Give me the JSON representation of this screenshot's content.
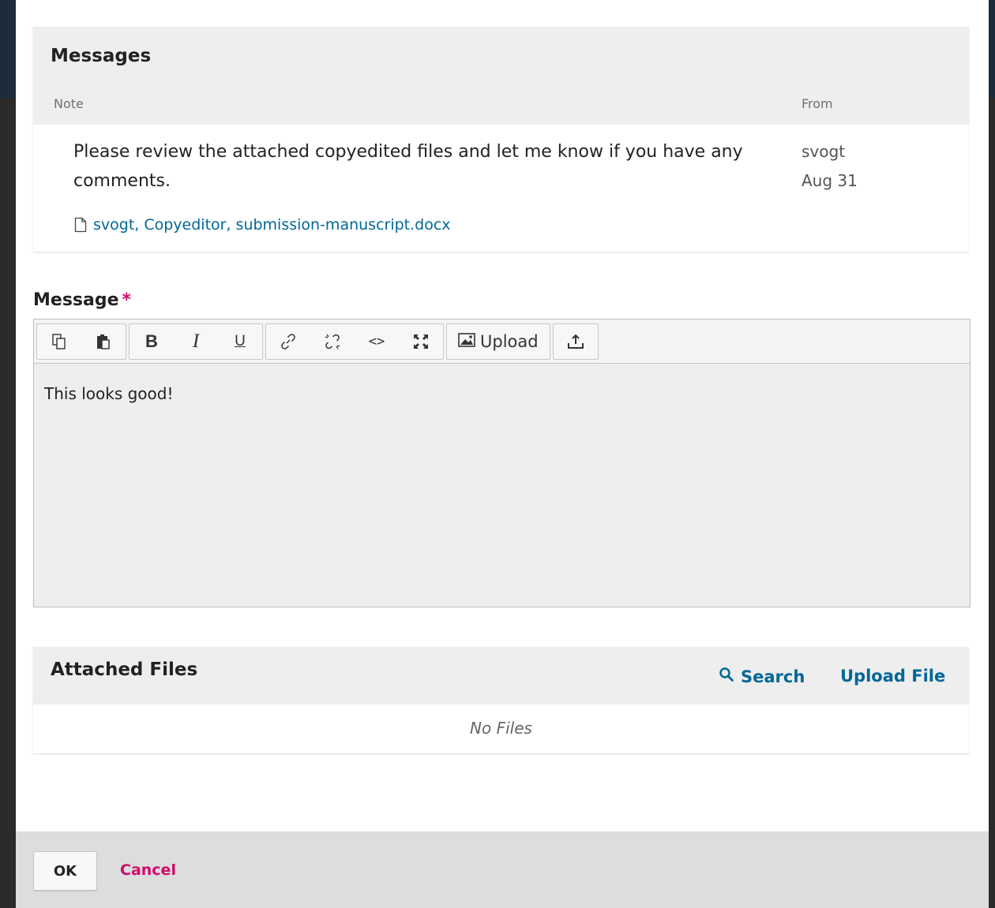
{
  "messages": {
    "title": "Messages",
    "columns": {
      "note": "Note",
      "from": "From"
    },
    "items": [
      {
        "text": "Please review the attached copyedited files and let me know if you have any comments.",
        "from_user": "svogt",
        "from_date": "Aug 31",
        "attachment": "svogt, Copyeditor, submission-manuscript.docx"
      }
    ]
  },
  "message_field": {
    "label": "Message",
    "required_mark": "*",
    "value": "This looks good!",
    "toolbar": {
      "buttons": [
        "copy-icon",
        "paste-icon",
        "bold-icon",
        "italic-icon",
        "underline-icon",
        "link-icon",
        "unlink-icon",
        "code-icon",
        "fullscreen-icon",
        "image-icon",
        "upload-icon"
      ],
      "bold_label": "B",
      "italic_label": "I",
      "underline_label": "U",
      "code_label": "<>",
      "upload_label": "Upload"
    }
  },
  "attached_files": {
    "title": "Attached Files",
    "search_label": "Search",
    "upload_label": "Upload File",
    "empty_text": "No Files"
  },
  "footer": {
    "ok_label": "OK",
    "cancel_label": "Cancel"
  },
  "colors": {
    "link": "#006798",
    "required": "#d00a6c",
    "panel_header": "#eeeeee"
  }
}
